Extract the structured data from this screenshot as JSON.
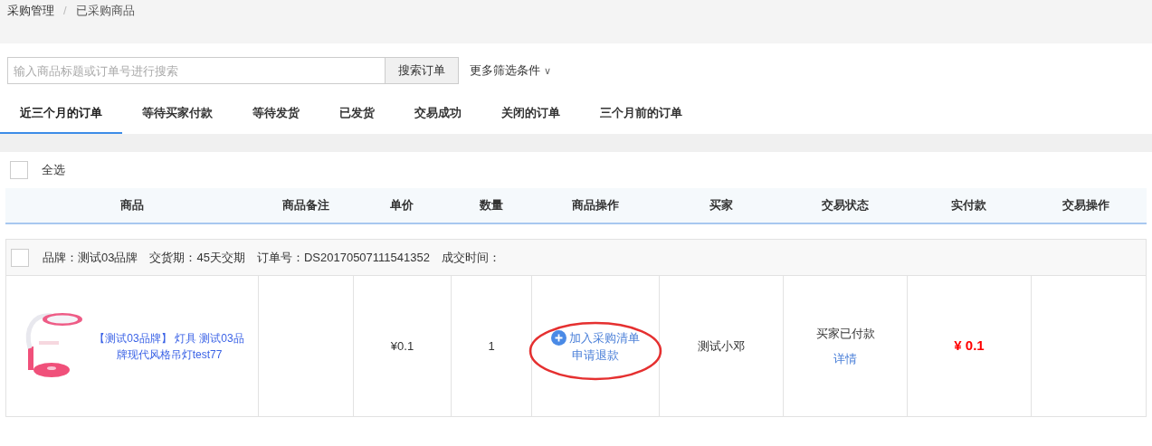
{
  "breadcrumb": [
    "采购管理",
    "已采购商品"
  ],
  "breadcrumb_separator": "/",
  "search": {
    "placeholder": "输入商品标题或订单号进行搜索",
    "button": "搜索订单",
    "more_filters": "更多筛选条件",
    "more_caret": "∨"
  },
  "tabs": [
    {
      "label": "近三个月的订单",
      "selected": true
    },
    {
      "label": "等待买家付款",
      "selected": false
    },
    {
      "label": "等待发货",
      "selected": false
    },
    {
      "label": "已发货",
      "selected": false
    },
    {
      "label": "交易成功",
      "selected": false
    },
    {
      "label": "关闭的订单",
      "selected": false
    },
    {
      "label": "三个月前的订单",
      "selected": false
    }
  ],
  "select_all": {
    "label": "全选",
    "checked": false
  },
  "table": {
    "columns": [
      "商品",
      "商品备注",
      "单价",
      "数量",
      "商品操作",
      "买家",
      "交易状态",
      "实付款",
      "交易操作"
    ],
    "orders": [
      {
        "checked": false,
        "info": "品牌：测试03品牌　交货期：45天交期　订单号：DS20170507111541352　成交时间：",
        "product": {
          "title": "【测试03品牌】 灯具 测试03品牌现代风格吊灯test77"
        },
        "price": "¥0.1",
        "quantity": "1",
        "actions": {
          "circled": true,
          "items": [
            "加入采购清单",
            "申请退款"
          ]
        },
        "buyer": "测试小邓",
        "status": "买家已付款",
        "details_link": "详情",
        "paid": "¥ 0.1"
      }
    ]
  }
}
